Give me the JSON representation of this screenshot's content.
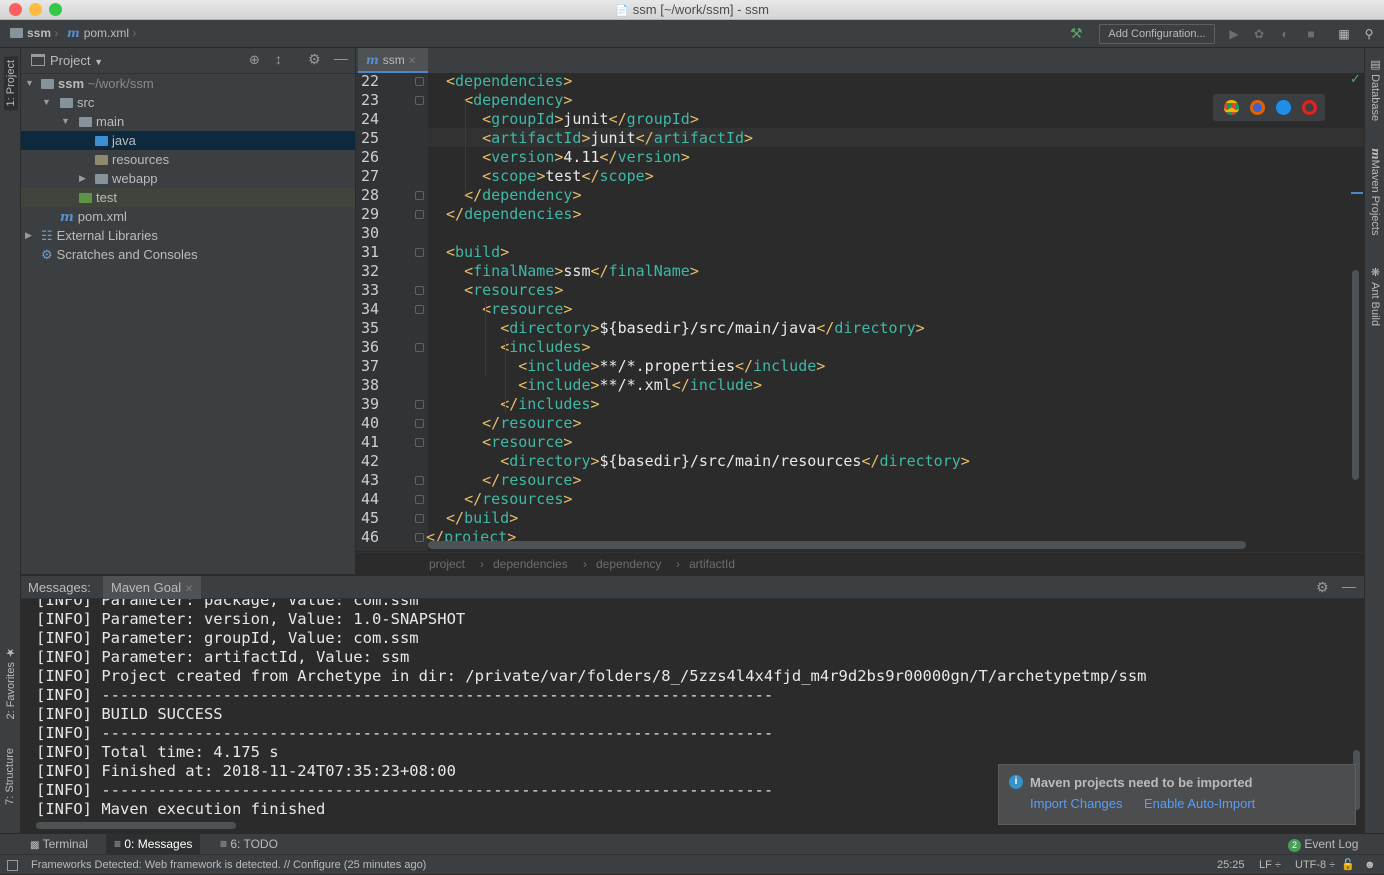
{
  "window": {
    "title": "ssm [~/work/ssm] - ssm"
  },
  "navbar": {
    "project": "ssm",
    "file": "pom.xml",
    "add_configuration": "Add Configuration..."
  },
  "project_panel": {
    "title": "Project",
    "tree": [
      {
        "label": "ssm",
        "suffix": "~/work/ssm"
      },
      {
        "label": "src"
      },
      {
        "label": "main"
      },
      {
        "label": "java"
      },
      {
        "label": "resources"
      },
      {
        "label": "webapp"
      },
      {
        "label": "test"
      },
      {
        "label": "pom.xml"
      },
      {
        "label": "External Libraries"
      },
      {
        "label": "Scratches and Consoles"
      }
    ]
  },
  "editor": {
    "tab": "ssm",
    "lines": [
      {
        "n": "22",
        "text": "<dependencies>"
      },
      {
        "n": "23",
        "text": "  <dependency>"
      },
      {
        "n": "24",
        "text": "    <groupId>junit</groupId>"
      },
      {
        "n": "25",
        "text": "    <artifactId>junit</artifactId>"
      },
      {
        "n": "26",
        "text": "    <version>4.11</version>"
      },
      {
        "n": "27",
        "text": "    <scope>test</scope>"
      },
      {
        "n": "28",
        "text": "  </dependency>"
      },
      {
        "n": "29",
        "text": "</dependencies>"
      },
      {
        "n": "30",
        "text": ""
      },
      {
        "n": "31",
        "text": "<build>"
      },
      {
        "n": "32",
        "text": "  <finalName>ssm</finalName>"
      },
      {
        "n": "33",
        "text": "  <resources>"
      },
      {
        "n": "34",
        "text": "    <resource>"
      },
      {
        "n": "35",
        "text": "      <directory>${basedir}/src/main/java</directory>"
      },
      {
        "n": "36",
        "text": "      <includes>"
      },
      {
        "n": "37",
        "text": "        <include>**/*.properties</include>"
      },
      {
        "n": "38",
        "text": "        <include>**/*.xml</include>"
      },
      {
        "n": "39",
        "text": "      </includes>"
      },
      {
        "n": "40",
        "text": "    </resource>"
      },
      {
        "n": "41",
        "text": "    <resource>"
      },
      {
        "n": "42",
        "text": "      <directory>${basedir}/src/main/resources</directory>"
      },
      {
        "n": "43",
        "text": "    </resource>"
      },
      {
        "n": "44",
        "text": "  </resources>"
      },
      {
        "n": "45",
        "text": "</build>"
      },
      {
        "n": "46",
        "text": "</project>"
      }
    ],
    "breadcrumb": [
      "project",
      "dependencies",
      "dependency",
      "artifactId"
    ]
  },
  "messages": {
    "label": "Messages:",
    "tab": "Maven Goal",
    "lines": [
      "[INFO] Parameter: package, Value: com.ssm",
      "[INFO] Parameter: version, Value: 1.0-SNAPSHOT",
      "[INFO] Parameter: groupId, Value: com.ssm",
      "[INFO] Parameter: artifactId, Value: ssm",
      "[INFO] Project created from Archetype in dir: /private/var/folders/8_/5zzs4l4x4fjd_m4r9d2bs9r00000gn/T/archetypetmp/ssm",
      "[INFO] ------------------------------------------------------------------------",
      "[INFO] BUILD SUCCESS",
      "[INFO] ------------------------------------------------------------------------",
      "[INFO] Total time: 4.175 s",
      "[INFO] Finished at: 2018-11-24T07:35:23+08:00",
      "[INFO] ------------------------------------------------------------------------",
      "[INFO] Maven execution finished"
    ]
  },
  "notification": {
    "title": "Maven projects need to be imported",
    "import_changes": "Import Changes",
    "enable_auto_import": "Enable Auto-Import"
  },
  "left_tabs": {
    "project": "1: Project",
    "favorites": "2: Favorites",
    "structure": "7: Structure"
  },
  "right_tabs": {
    "database": "Database",
    "maven": "Maven Projects",
    "ant": "Ant Build"
  },
  "bottom_tabs": {
    "terminal": "Terminal",
    "messages": "0: Messages",
    "todo": "6: TODO",
    "event_log": "Event Log",
    "event_count": "2"
  },
  "status": {
    "message": "Frameworks Detected: Web framework is detected. // Configure (25 minutes ago)",
    "position": "25:25",
    "line_sep": "LF ÷",
    "encoding": "UTF-8 ÷"
  }
}
